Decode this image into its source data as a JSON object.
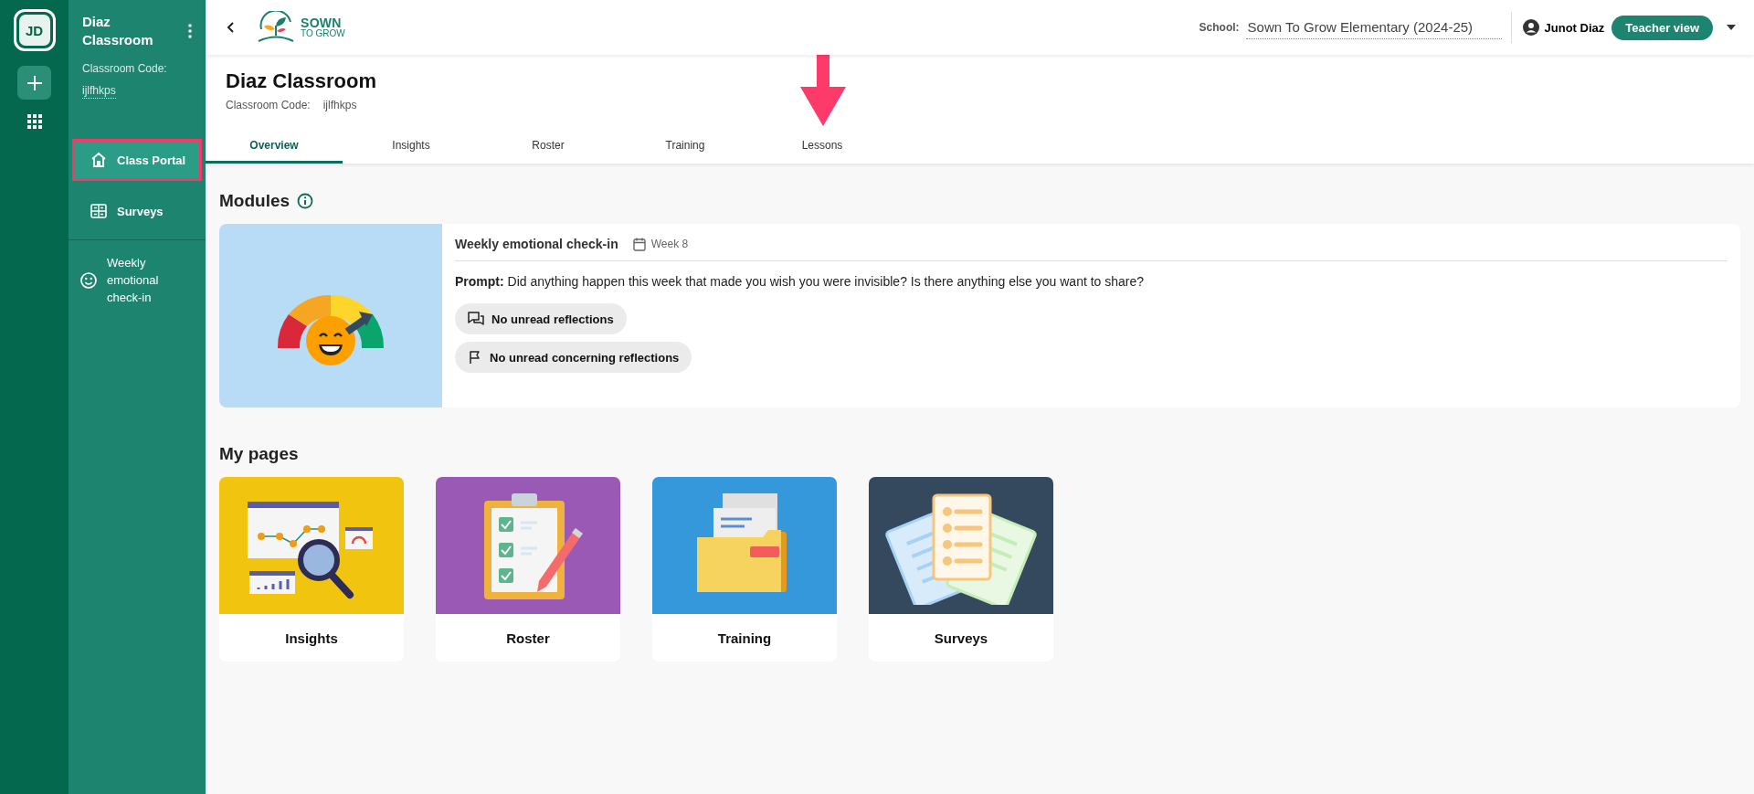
{
  "rail": {
    "avatar": "JD"
  },
  "sidebar": {
    "title": "Diaz Classroom",
    "code_label": "Classroom Code:",
    "code": "ijlfhkps",
    "items": [
      {
        "kind": "portal",
        "label": "Class Portal",
        "selected": true,
        "highlighted": true
      },
      {
        "kind": "surveys",
        "label": "Surveys",
        "selected": false,
        "highlighted": false
      },
      {
        "kind": "module",
        "label": "Weekly emotional check-in",
        "selected": false,
        "highlighted": false
      }
    ]
  },
  "topbar": {
    "logo_top": "SOWN",
    "logo_bottom": "TO GROW",
    "school_label": "School:",
    "school": "Sown To Grow Elementary (2024-25)",
    "user": "Junot Diaz",
    "view_button": "Teacher view"
  },
  "header": {
    "title": "Diaz Classroom",
    "code_label": "Classroom Code:",
    "code": "ijlfhkps",
    "tabs": [
      {
        "label": "Overview",
        "selected": true,
        "pointed": false
      },
      {
        "label": "Insights",
        "selected": false,
        "pointed": false
      },
      {
        "label": "Roster",
        "selected": false,
        "pointed": false
      },
      {
        "label": "Training",
        "selected": false,
        "pointed": false
      },
      {
        "label": "Lessons",
        "selected": false,
        "pointed": true
      }
    ]
  },
  "modules": {
    "heading": "Modules",
    "cards": [
      {
        "title": "Weekly emotional check-in",
        "week": "Week 8",
        "prompt": "**Prompt:** Did anything happen this week that made you wish you were invisible? Is there anything else you want to share?",
        "chips": [
          {
            "kind": "reflections",
            "label": "No unread reflections"
          },
          {
            "kind": "concerning",
            "label": "No unread concerning reflections"
          }
        ]
      }
    ]
  },
  "pages": {
    "heading": "My pages",
    "tiles": [
      {
        "kind": "insights",
        "label": "Insights",
        "color": "#f1c40f"
      },
      {
        "kind": "roster",
        "label": "Roster",
        "color": "#9b59b6"
      },
      {
        "kind": "training",
        "label": "Training",
        "color": "#3498db"
      },
      {
        "kind": "surveys",
        "label": "Surveys",
        "color": "#34495e"
      }
    ]
  }
}
